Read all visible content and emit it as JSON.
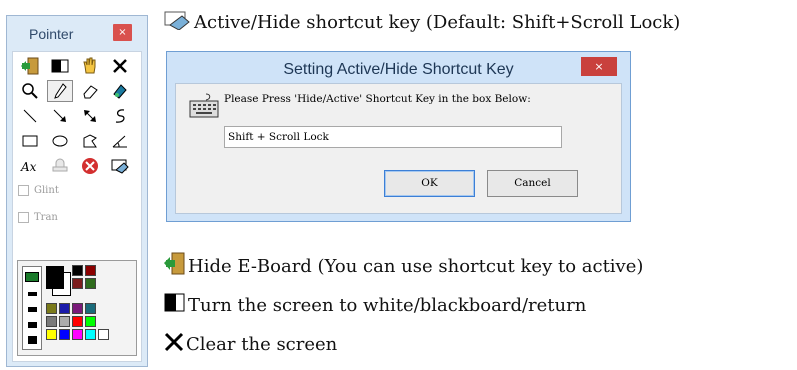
{
  "palette": {
    "title": "Pointer",
    "close_glyph": "×",
    "checkboxes": [
      {
        "label": "Glint",
        "checked": false
      },
      {
        "label": "Tran",
        "checked": false
      }
    ],
    "tools": [
      [
        "hide-door-icon",
        "screen-toggle-icon",
        "hand-icon",
        "clear-icon"
      ],
      [
        "magnifier-icon",
        "pen-icon",
        "eraser-icon",
        "highlighter-icon"
      ],
      [
        "line-icon",
        "arrow-icon",
        "double-arrow-icon",
        "curve-icon"
      ],
      [
        "rectangle-icon",
        "ellipse-icon",
        "polygon-icon",
        "angle-icon"
      ],
      [
        "text-icon",
        "stamp-icon",
        "exit-icon",
        "shortcut-icon"
      ]
    ],
    "swatch_colors": [
      "#000000",
      "#8b0000",
      "#7c1c1c",
      "#2e6b1c",
      "#7a7a1a",
      "#1a1aaa",
      "#7a1a7a",
      "#1a6b7a",
      "#7a7a7a",
      "#ababab",
      "#ff0000",
      "#00ff00",
      "#ffff00",
      "#0000ff",
      "#ff00ff",
      "#00ffff",
      "#ffffff"
    ]
  },
  "help": {
    "active_hide": "Active/Hide shortcut key (Default: Shift+Scroll Lock)",
    "hide_board": "Hide E-Board (You can use shortcut key to active)",
    "turn_screen": "Turn the screen to white/blackboard/return",
    "clear_screen": "Clear the screen"
  },
  "dialog": {
    "title": "Setting Active/Hide Shortcut Key",
    "close_glyph": "×",
    "prompt": "Please Press 'Hide/Active' Shortcut Key in the box Below:",
    "field_value": "Shift + Scroll Lock",
    "ok_label": "OK",
    "cancel_label": "Cancel"
  }
}
